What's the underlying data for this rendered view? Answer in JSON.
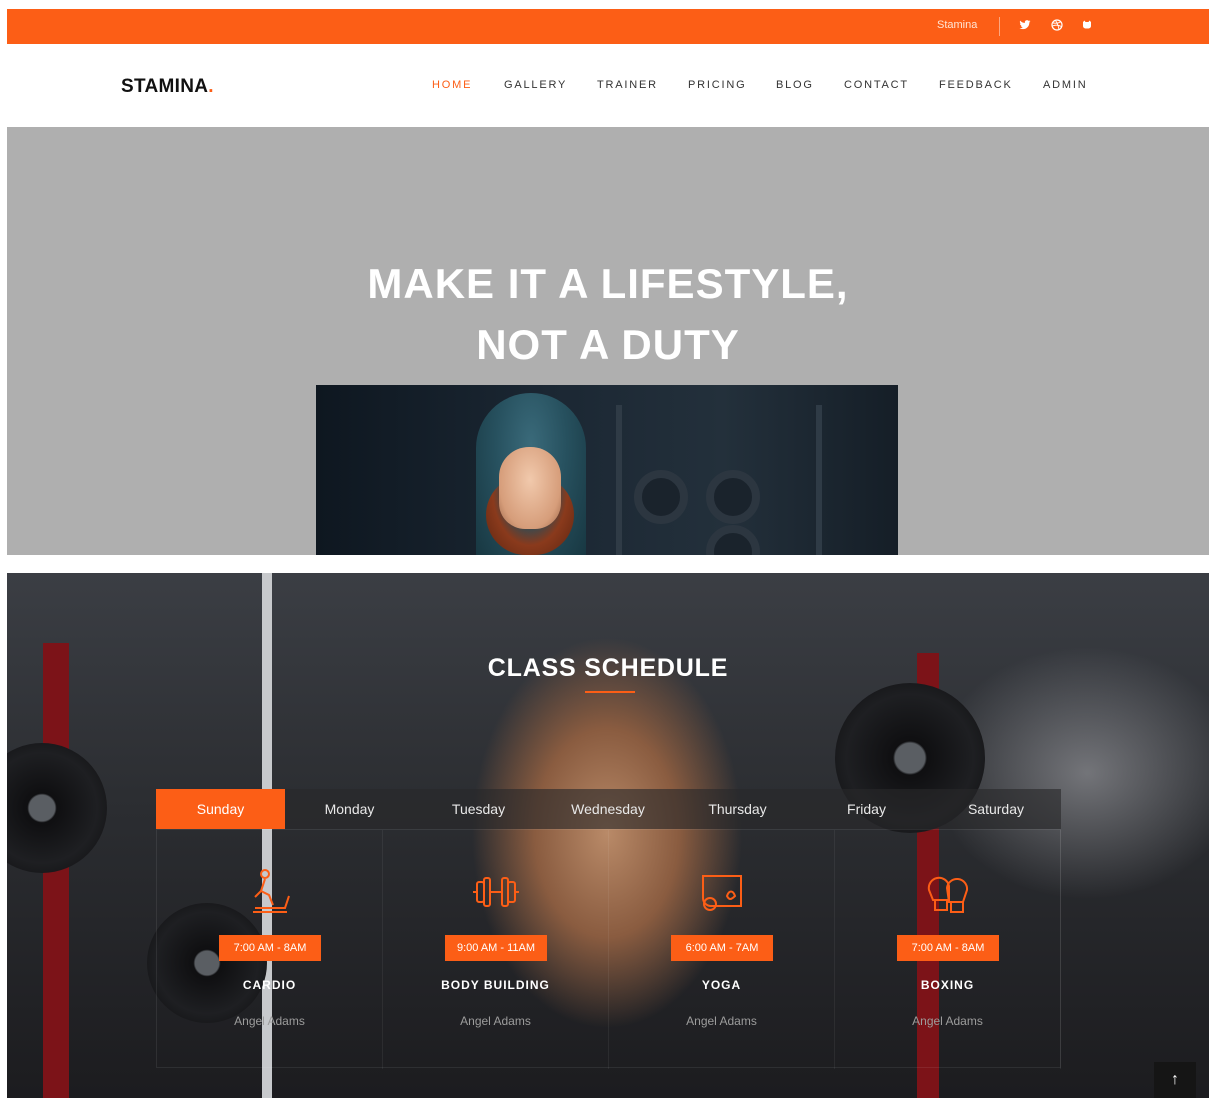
{
  "topbar": {
    "brand_link": "Stamina",
    "social_icons": [
      "twitter-icon",
      "dribbble-icon",
      "github-icon"
    ]
  },
  "header": {
    "logo_text": "STAMINA",
    "logo_dot": ".",
    "nav": [
      {
        "label": "HOME",
        "active": true
      },
      {
        "label": "GALLERY",
        "active": false
      },
      {
        "label": "TRAINER",
        "active": false
      },
      {
        "label": "PRICING",
        "active": false
      },
      {
        "label": "BLOG",
        "active": false
      },
      {
        "label": "CONTACT",
        "active": false
      },
      {
        "label": "FEEDBACK",
        "active": false
      },
      {
        "label": "ADMIN",
        "active": false
      }
    ]
  },
  "hero": {
    "title_line1": "MAKE IT A LIFESTYLE,",
    "title_line2": "NOT A DUTY"
  },
  "schedule": {
    "title": "CLASS SCHEDULE",
    "tabs": [
      "Sunday",
      "Monday",
      "Tuesday",
      "Wednesday",
      "Thursday",
      "Friday",
      "Saturday"
    ],
    "active_tab": "Sunday",
    "classes": [
      {
        "icon": "treadmill-icon",
        "time": "7:00 AM - 8AM",
        "name": "CARDIO",
        "trainer": "Angel Adams"
      },
      {
        "icon": "dumbbell-icon",
        "time": "9:00 AM - 11AM",
        "name": "BODY BUILDING",
        "trainer": "Angel Adams"
      },
      {
        "icon": "yoga-mat-icon",
        "time": "6:00 AM - 7AM",
        "name": "YOGA",
        "trainer": "Angel Adams"
      },
      {
        "icon": "boxing-gloves-icon",
        "time": "7:00 AM - 8AM",
        "name": "BOXING",
        "trainer": "Angel Adams"
      }
    ]
  },
  "scroll_top_icon": "arrow-up-icon",
  "scroll_top_label": "↑",
  "colors": {
    "accent": "#fc5e16",
    "hero_bg": "#afafaf"
  }
}
